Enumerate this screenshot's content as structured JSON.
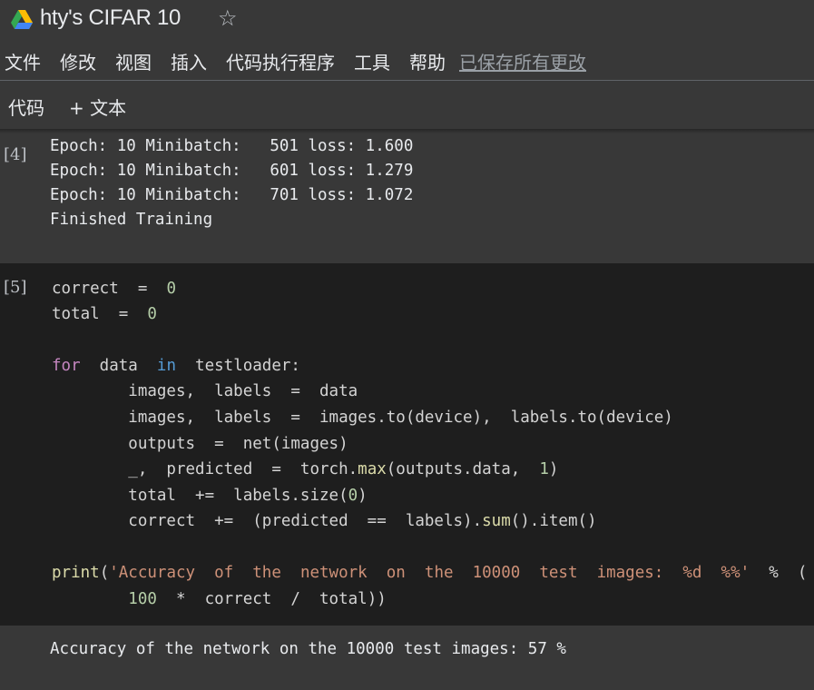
{
  "app": {
    "title": "hty's CIFAR 10",
    "star_glyph": "☆"
  },
  "menu": {
    "items": [
      "文件",
      "修改",
      "视图",
      "插入",
      "代码执行程序",
      "工具",
      "帮助"
    ],
    "save_status": "已保存所有更改"
  },
  "toolbar": {
    "code_label": "代码",
    "text_label": "+ 文本"
  },
  "cells": {
    "cell4": {
      "exec_count": "[4]",
      "output_lines": [
        "Epoch: 10 Minibatch:   501 loss: 1.600",
        "Epoch: 10 Minibatch:   601 loss: 1.279",
        "Epoch: 10 Minibatch:   701 loss: 1.072",
        "Finished Training"
      ]
    },
    "cell5": {
      "exec_count": "[5]",
      "output": "Accuracy of the network on the 10000 test images: 57 %"
    }
  },
  "colors": {
    "background": "#383838",
    "code_background": "#1e1e1e",
    "keyword": "#c586c0",
    "keyword_in": "#569cd6",
    "function": "#dcdcaa",
    "number": "#b5cea8",
    "string": "#ce9178"
  },
  "icons": {
    "logo": "google-drive-icon",
    "star": "star-outline-icon"
  }
}
